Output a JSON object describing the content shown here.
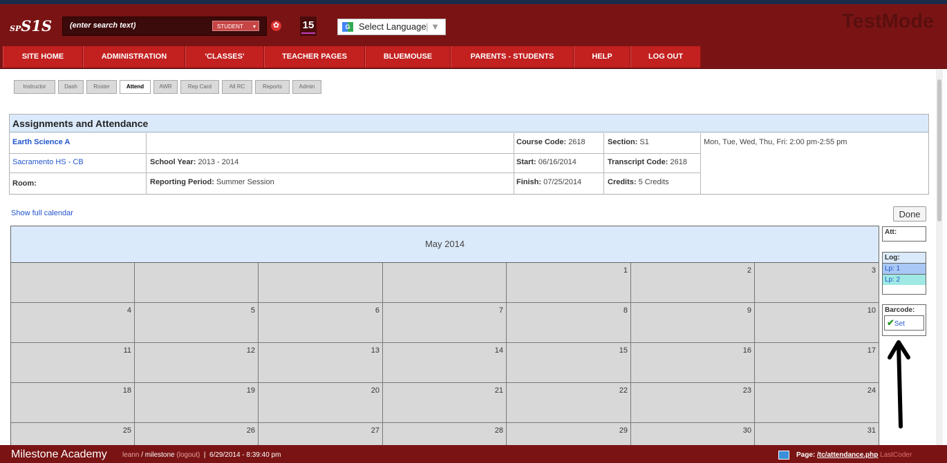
{
  "header": {
    "logo_prefix": "SP",
    "logo_main": "S1S",
    "search_placeholder": "(enter search text)",
    "search_scope": "STUDENT",
    "notification_count": "15",
    "language_label": "Select Language",
    "mode_label": "TestMode"
  },
  "nav": {
    "items": [
      "SITE HOME",
      "ADMINISTRATION",
      "'CLASSES'",
      "TEACHER PAGES",
      "BLUEMOUSE",
      "PARENTS - STUDENTS",
      "HELP",
      "LOG OUT"
    ]
  },
  "subtabs": [
    "Instructor",
    "Dash",
    "Roster",
    "Attend",
    "AWR",
    "Rep Card",
    "All RC",
    "Reports",
    "Admin"
  ],
  "info": {
    "title": "Assignments and Attendance",
    "course_name": "Earth Science A",
    "school": "Sacramento HS - CB",
    "room_label": "Room:",
    "school_year_label": "School Year:",
    "school_year": "2013 - 2014",
    "reporting_period_label": "Reporting Period:",
    "reporting_period": "Summer Session",
    "course_code_label": "Course Code:",
    "course_code": "2618",
    "start_label": "Start:",
    "start": "06/16/2014",
    "finish_label": "Finish:",
    "finish": "07/25/2014",
    "section_label": "Section:",
    "section": "S1",
    "transcript_label": "Transcript Code:",
    "transcript": "2618",
    "credits_label": "Credits:",
    "credits": "5 Credits",
    "schedule": "Mon, Tue, Wed, Thu, Fri: 2:00 pm-2:55 pm"
  },
  "calendar": {
    "show_full_label": "Show full calendar",
    "done_label": "Done",
    "month": "May 2014",
    "days": [
      "",
      "",
      "",
      "",
      "1",
      "2",
      "3",
      "4",
      "5",
      "6",
      "7",
      "8",
      "9",
      "10",
      "11",
      "12",
      "13",
      "14",
      "15",
      "16",
      "17",
      "18",
      "19",
      "20",
      "21",
      "22",
      "23",
      "24",
      "25",
      "26",
      "27",
      "28",
      "29",
      "30",
      "31"
    ]
  },
  "sidebar": {
    "att_label": "Att:",
    "log_label": "Log:",
    "lp1": "Lp: 1",
    "lp2": "Lp: 2",
    "barcode_label": "Barcode:",
    "set_label": "Set",
    "colors": {
      "lp1": "#a9c8f5",
      "lp2": "#9fe8e4"
    }
  },
  "footer": {
    "school": "Milestone Academy",
    "user": "leann",
    "account": "/ milestone",
    "logout": "(logout)",
    "separator": "|",
    "timestamp": "6/29/2014 - 8:39:40 pm",
    "page_label": "Page:",
    "page": "/tc/attendance.php",
    "last_coder": "LastCoder"
  },
  "colors": {
    "brand": "#7a1414",
    "nav": "#c32020",
    "header_bg": "#dbeafb",
    "cell_bg": "#d8d8d8"
  }
}
